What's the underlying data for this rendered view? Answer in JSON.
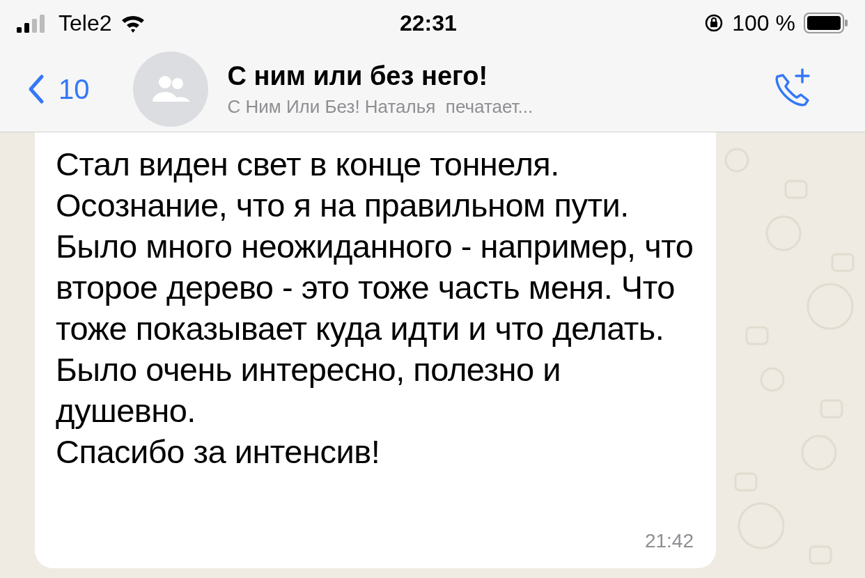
{
  "status_bar": {
    "carrier": "Tele2",
    "time": "22:31",
    "battery": "100 %"
  },
  "header": {
    "back_count": "10",
    "title": "С ним или без него!",
    "subtitle": "С Ним Или Без! Наталья  печатает..."
  },
  "message": {
    "paragraphs": [
      "Стал виден свет в конце тоннеля.",
      "Осознание, что я на правильном пути.",
      "Было много неожиданного - например, что второе дерево - это тоже часть меня. Что тоже показывает куда идти и что делать.",
      "Было очень интересно, полезно и душевно.",
      "Спасибо за интенсив!"
    ],
    "time": "21:42"
  }
}
